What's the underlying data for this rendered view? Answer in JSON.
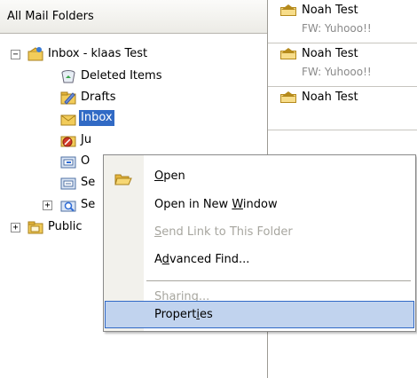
{
  "folder_pane": {
    "header": "All Mail Folders",
    "tree": [
      {
        "id": "mailbox",
        "label": "Inbox - klaas Test",
        "expander": "−",
        "icon": "mailbox-icon"
      },
      {
        "id": "deleted",
        "label": "Deleted Items",
        "icon": "deleted-items-icon"
      },
      {
        "id": "drafts",
        "label": "Drafts",
        "icon": "drafts-icon"
      },
      {
        "id": "inbox",
        "label": "Inbox",
        "icon": "inbox-icon"
      },
      {
        "id": "junk",
        "label": "Ju",
        "icon": "junk-icon"
      },
      {
        "id": "outbox",
        "label": "O",
        "icon": "outbox-icon"
      },
      {
        "id": "sent",
        "label": "Se",
        "icon": "sent-items-icon"
      },
      {
        "id": "search",
        "label": "Se",
        "expander": "+",
        "icon": "search-folders-icon"
      },
      {
        "id": "public",
        "label": "Public",
        "expander": "+",
        "icon": "public-folders-icon"
      }
    ]
  },
  "messages": [
    {
      "sender": "Noah Test",
      "subject": "FW: Yuhooo!!"
    },
    {
      "sender": "Noah Test",
      "subject": "FW: Yuhooo!!"
    },
    {
      "sender": "Noah Test",
      "subject": ""
    }
  ],
  "context_menu": {
    "open": {
      "pre": "",
      "acc": "O",
      "post": "pen"
    },
    "open_new_window": {
      "pre": "Open in New ",
      "acc": "W",
      "post": "indow"
    },
    "send_link": {
      "pre": "",
      "acc": "S",
      "post": "end Link to This Folder"
    },
    "advanced_find": {
      "pre": "A",
      "acc": "d",
      "post": "vanced Find..."
    },
    "sharing": {
      "pre": "Sh",
      "acc": "a",
      "post": "ring..."
    },
    "properties": {
      "pre": "Propert",
      "acc": "i",
      "post": "es"
    }
  },
  "colors": {
    "selection": "#c1d3ee",
    "selection_border": "#3169c6",
    "disabled_text": "#a7a69f"
  }
}
